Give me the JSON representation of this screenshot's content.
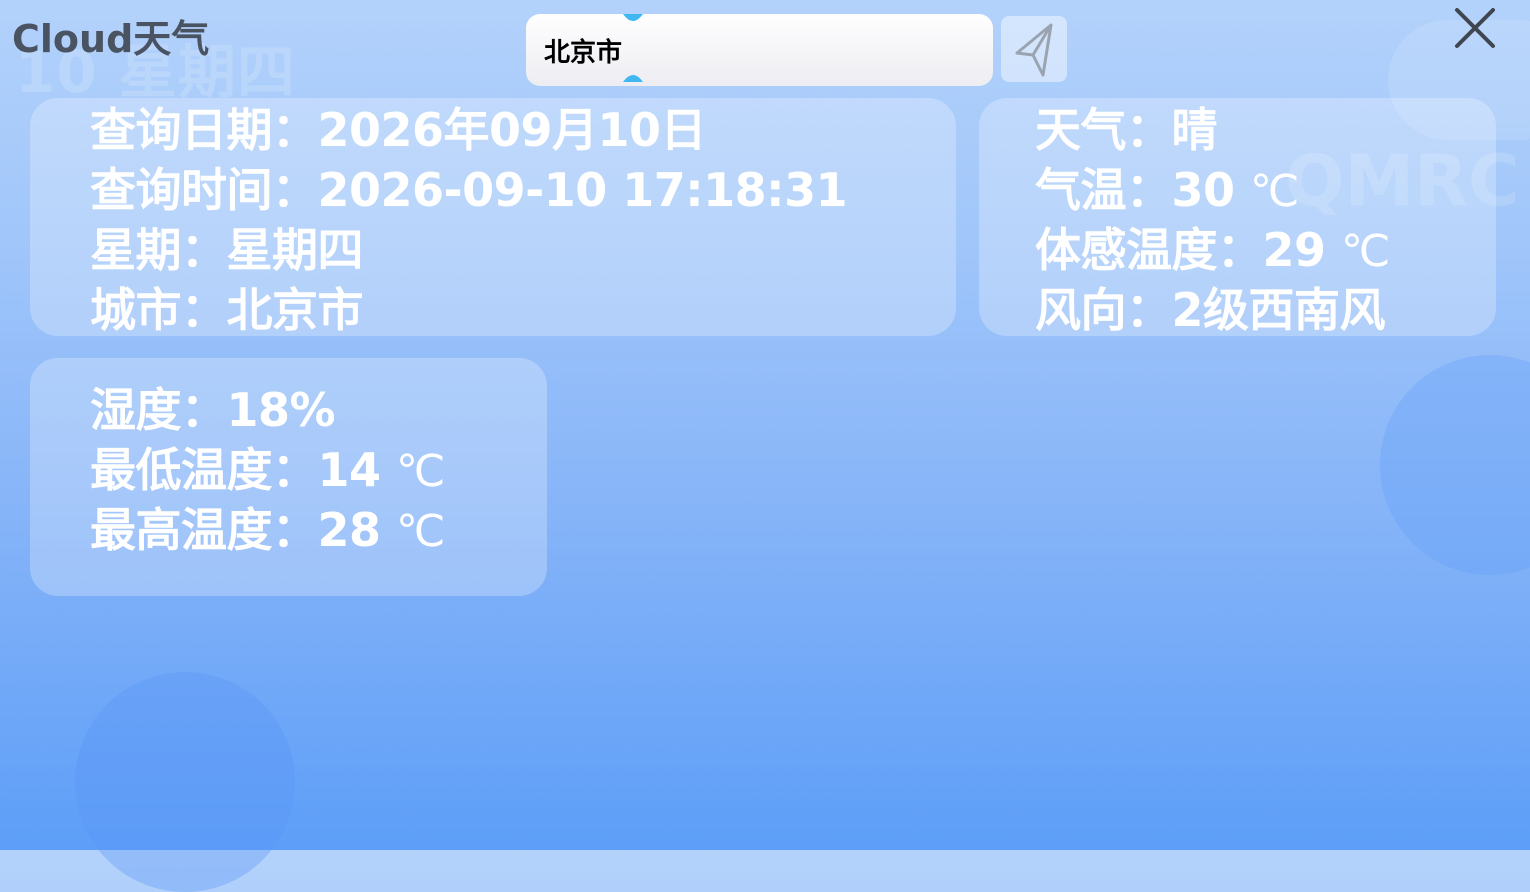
{
  "app": {
    "title": "Cloud天气"
  },
  "background": {
    "ghost_date": "10 星期四",
    "watermark": "QMRC"
  },
  "search": {
    "value": "北京市"
  },
  "icons": {
    "send": "send-icon",
    "close": "close-icon",
    "handle": "text-selection-handle-icon"
  },
  "colors": {
    "card_bg": "rgba(255,255,255,0.25)",
    "text": "#ffffff",
    "title": "#4a5361",
    "handle": "#3fb8f2"
  },
  "info_card": {
    "date_label": "查询日期：",
    "date_value": "2026年09月10日",
    "time_label": "查询时间：",
    "time_value": "2026-09-10 17:18:31",
    "weekday_label": "星期：",
    "weekday_value": "星期四",
    "city_label": "城市：",
    "city_value": "北京市"
  },
  "weather_card": {
    "weather_label": "天气：",
    "weather_value": "晴",
    "temp_label": "气温：",
    "temp_value": "30",
    "temp_unit": "℃",
    "feels_label": "体感温度：",
    "feels_value": "29",
    "feels_unit": "℃",
    "wind_label": "风向：",
    "wind_value": "2级西南风"
  },
  "extra_card": {
    "humidity_label": "湿度：",
    "humidity_value": "18%",
    "min_label": "最低温度：",
    "min_value": "14",
    "min_unit": "℃",
    "max_label": "最高温度：",
    "max_value": "28",
    "max_unit": "℃"
  }
}
